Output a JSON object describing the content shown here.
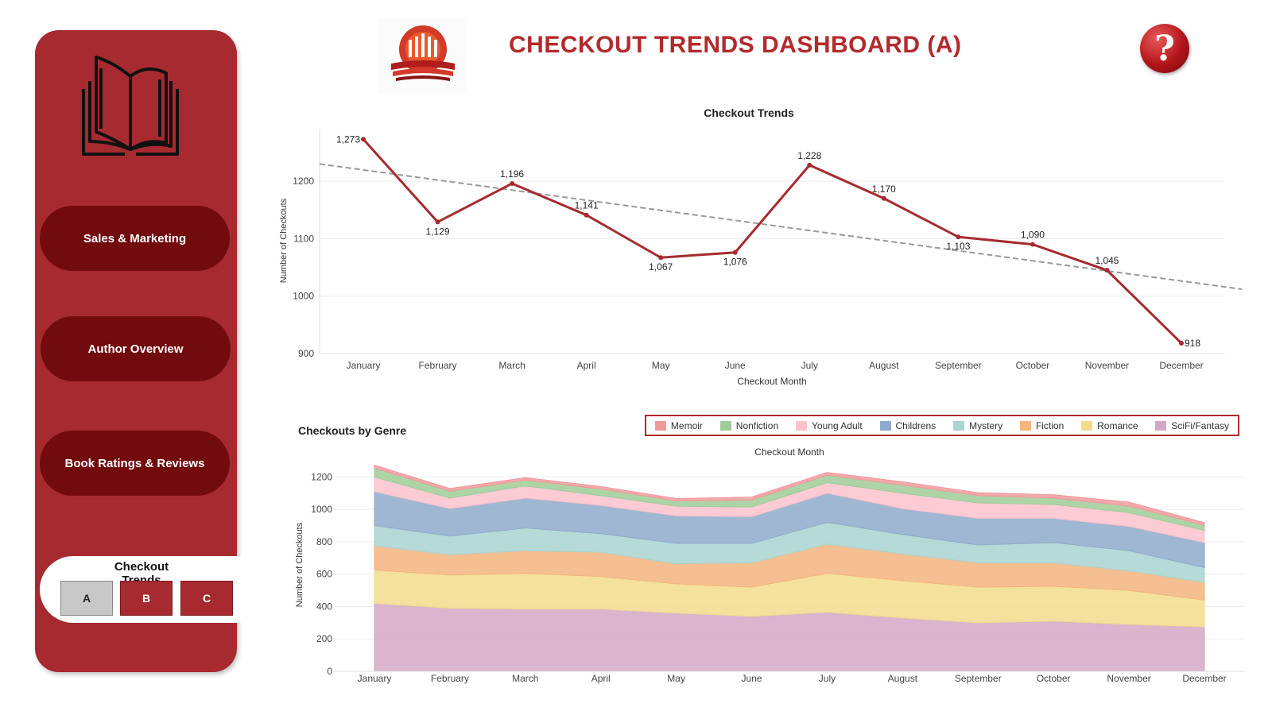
{
  "title": "CHECKOUT TRENDS DASHBOARD (A)",
  "sidebar": {
    "nav": [
      "Sales & Marketing",
      "Author Overview",
      "Book Ratings & Reviews"
    ],
    "tabs_title": "Checkout Trends",
    "tabs": [
      "A",
      "B",
      "C"
    ],
    "active_tab": "A"
  },
  "help_label": "?",
  "icons": {
    "book": "open-book-icon",
    "logo": "library-logo",
    "help": "question-mark-icon"
  },
  "colors": {
    "sidebar": "#a62a2f",
    "nav_button": "#720b0d",
    "title": "#b22a2c",
    "line": "#a62a2f",
    "trend": "#9a9a9a"
  },
  "chart_data": [
    {
      "type": "line",
      "title": "Checkout Trends",
      "xlabel": "Checkout Month",
      "ylabel": "Number of Checkouts",
      "categories": [
        "January",
        "February",
        "March",
        "April",
        "May",
        "June",
        "July",
        "August",
        "September",
        "October",
        "November",
        "December"
      ],
      "values": [
        1273,
        1129,
        1196,
        1141,
        1067,
        1076,
        1228,
        1170,
        1103,
        1090,
        1045,
        918
      ],
      "data_labels": [
        "1,273",
        "1,129",
        "1,196",
        "1,141",
        "1,067",
        "1,076",
        "1,228",
        "1,170",
        "1,103",
        "1,090",
        "1,045",
        "918"
      ],
      "y_ticks": [
        900,
        1000,
        1100,
        1200
      ],
      "ylim": [
        900,
        1290
      ],
      "trendline": {
        "style": "dashed",
        "start": 1230,
        "end": 1012
      },
      "grid": true
    },
    {
      "type": "area",
      "stacked": true,
      "title": "Checkouts by Genre",
      "xlabel": "Checkout Month",
      "ylabel": "Number of Checkouts",
      "categories": [
        "January",
        "February",
        "March",
        "April",
        "May",
        "June",
        "July",
        "August",
        "September",
        "October",
        "November",
        "December"
      ],
      "y_ticks": [
        0,
        200,
        400,
        600,
        800,
        1000,
        1200
      ],
      "ylim": [
        0,
        1300
      ],
      "legend_position": "top-right",
      "series": [
        {
          "name": "SciFi/Fantasy",
          "color": "#d2a8c6",
          "values": [
            420,
            390,
            385,
            385,
            360,
            340,
            365,
            330,
            300,
            310,
            290,
            275
          ]
        },
        {
          "name": "Romance",
          "color": "#f2dc8c",
          "values": [
            205,
            205,
            220,
            200,
            180,
            180,
            240,
            230,
            220,
            215,
            210,
            165
          ]
        },
        {
          "name": "Fiction",
          "color": "#f4b47e",
          "values": [
            150,
            125,
            140,
            150,
            125,
            150,
            180,
            165,
            150,
            145,
            120,
            110
          ]
        },
        {
          "name": "Mystery",
          "color": "#a9d4d0",
          "values": [
            125,
            115,
            140,
            115,
            125,
            120,
            135,
            120,
            110,
            125,
            125,
            90
          ]
        },
        {
          "name": "Childrens",
          "color": "#8faacb",
          "values": [
            210,
            170,
            185,
            175,
            170,
            165,
            180,
            160,
            165,
            150,
            150,
            155
          ]
        },
        {
          "name": "Young Adult",
          "color": "#fbc2cc",
          "values": [
            90,
            65,
            75,
            60,
            60,
            60,
            65,
            95,
            95,
            85,
            85,
            75
          ]
        },
        {
          "name": "Nonfiction",
          "color": "#9fcc98",
          "values": [
            55,
            42,
            36,
            40,
            32,
            42,
            46,
            50,
            45,
            40,
            40,
            32
          ]
        },
        {
          "name": "Memoir",
          "color": "#f09a9c",
          "values": [
            18,
            17,
            15,
            16,
            15,
            19,
            17,
            20,
            18,
            20,
            25,
            16
          ]
        }
      ],
      "legend_order": [
        "Memoir",
        "Nonfiction",
        "Young Adult",
        "Childrens",
        "Mystery",
        "Fiction",
        "Romance",
        "SciFi/Fantasy"
      ]
    }
  ]
}
